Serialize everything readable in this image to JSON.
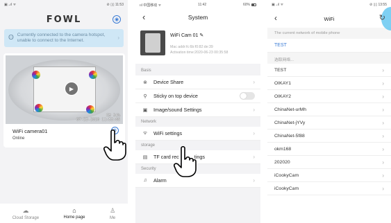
{
  "phone1": {
    "status": {
      "left": "▣ ₊ıl ᯤ",
      "right": "⊘ ▯▯ 11:53"
    },
    "brand": "FOWL",
    "banner": {
      "text_line1": "Currently connected to the camera hotspot,",
      "text_line2": "unable to connect to the Internet."
    },
    "camera": {
      "name": "WiFi camera01",
      "status": "Online",
      "osd_line1": "CH 54%",
      "osd_line2": "07-23-2020 11:53:09"
    },
    "tabs": [
      {
        "label": "Cloud Storage",
        "icon": "cloud-icon"
      },
      {
        "label": "Home page",
        "icon": "home-icon"
      },
      {
        "label": "Me",
        "icon": "person-icon"
      }
    ]
  },
  "phone2": {
    "status": {
      "left": "ııl 中国移动 ᯤ",
      "center": "11:42",
      "right": "60%"
    },
    "title": "System",
    "device": {
      "name": "WiFi Cam 01",
      "mac": "Mac addr:fc:6b:f0:82:de:39",
      "activation": "Activation time:2020-06-23 00:35:58"
    },
    "sections": {
      "basis": "Basis",
      "network": "Network",
      "storage": "storage",
      "security": "Security"
    },
    "rows": {
      "device_share": "Device Share",
      "sticky": "Sticky on top device",
      "image_sound": "Image/sound Settings",
      "wifi": "WiFi settings",
      "tf_left": "TF card rec",
      "tf_right": "tings",
      "alarm": "Alarm"
    }
  },
  "phone3": {
    "status": {
      "left": "▣ ₊ıl ᯤ",
      "right": "⊘ ▯▯ 13:55"
    },
    "title": "WiFi",
    "current_label": "The current network of mobile phone",
    "current_network": "TEST",
    "select_label": "选取网络...",
    "networks": [
      "TEST",
      "OIKAY1",
      "OIKAY2",
      "ChinaNet-urMh",
      "ChinaNet-jYVy",
      "ChinaNet-5f88",
      "okm168",
      "202020",
      "iCookyCam",
      "iCookyCam"
    ]
  },
  "colors": {
    "accent_blue": "#3a7bd5",
    "banner_bg": "#cfe7f6",
    "page_bg": "#f3f3f5"
  }
}
